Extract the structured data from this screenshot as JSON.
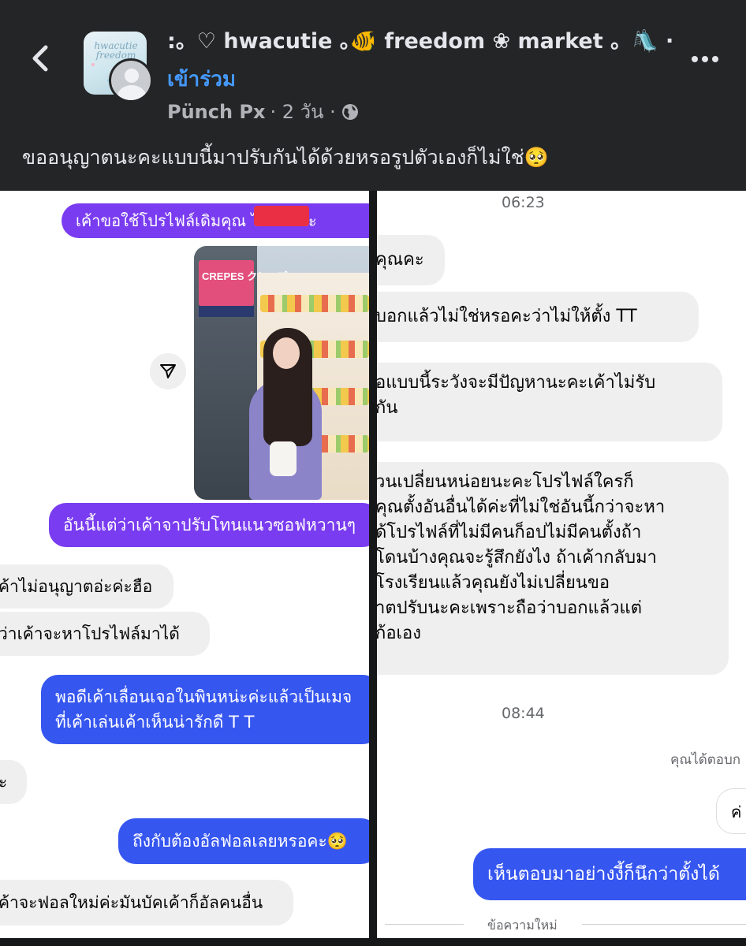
{
  "header": {
    "back_icon": "chevron-left-icon",
    "group_name": ":。♡ hwacutie ｡🐠 freedom ❀ market 。🛝 ·",
    "group_avatar_text": "hwacutie freedom",
    "join_label": "เข้าร่วม",
    "author": "Pünch Px",
    "time_ago": "· 2 วัน ·",
    "visibility_icon": "globe-icon",
    "more_icon": "more-horizontal-icon"
  },
  "post": {
    "caption": "ขออนุญาตนะคะแบบนี้มาปรับกันได้ด้วยหรอรูปตัวเองก็ไม่ใช่🥺"
  },
  "left_chat": {
    "msg1": "เค้าขอใช้โปรไฟล์เดิมคุณ      ได้ม้ายคะ",
    "photo_sign": "CREPES クレープ",
    "msg2": "อันนี้แต่ว่าเค้าจาปรับโทนแนวซอฟหวานๆ",
    "msg3": "ค้าไม่อนุญาตอ่ะค่ะฮือ",
    "msg4": "ว่าเค้าจะหาโปรไฟล์มาได้",
    "msg5_line1": "พอดีเค้าเลื่อนเจอในพินหน่ะค่ะแล้วเป็นเมจ",
    "msg5_line2": "ที่เค้าเล่นเค้าเห็นน่ารักดี T T",
    "msg6": "ะ",
    "msg7": "ถึงกับต้องอัลฟอลเลยหรอคะ🥺",
    "msg8": "ค้าจะฟอลใหม่ค่ะมันบัคเค้าก็อัลคนอื่น"
  },
  "right_chat": {
    "time1": "06:23",
    "msg1": "คุณคะ",
    "msg2": "บอกแล้วไม่ใช่หรอคะว่าไม่ให้ตั้ง TT",
    "msg3_line1": "อแบบนี้ระวังจะมีปัญหานะคะเค้าไม่รับ",
    "msg3_line2": "กัน",
    "msg4_lines": [
      "วนเปลี่ยนหน่อยนะคะโปรไฟล์ใครก็",
      "คุณตั้งอันอื่นได้ค่ะที่ไม่ใช่อันนี้กว่าจะหา",
      "ด้โปรไฟล์ที่ไม่มีคนก็อปไม่มีคนตั้งถ้า",
      "โดนบ้างคุณจะรู้สึกยังไง ถ้าเค้ากลับมา",
      "โรงเรียนแล้วคุณยังไม่เปลี่ยนขอ",
      "าตปรับนะคะเพราะถือว่าบอกแล้วแต่",
      "ก้อเอง"
    ],
    "time2": "08:44",
    "replied_label": "คุณได้ตอบก",
    "msg5": "ค่",
    "msg6": "เห็นตอบมาอย่างงี้ก็นึกว่าตั้งได้",
    "new_messages": "ข้อความใหม่"
  },
  "colors": {
    "background": "#242526",
    "link": "#4599ff",
    "sent_purple": "#7a3cf0",
    "sent_blue": "#3656f0",
    "received": "#efefef"
  }
}
